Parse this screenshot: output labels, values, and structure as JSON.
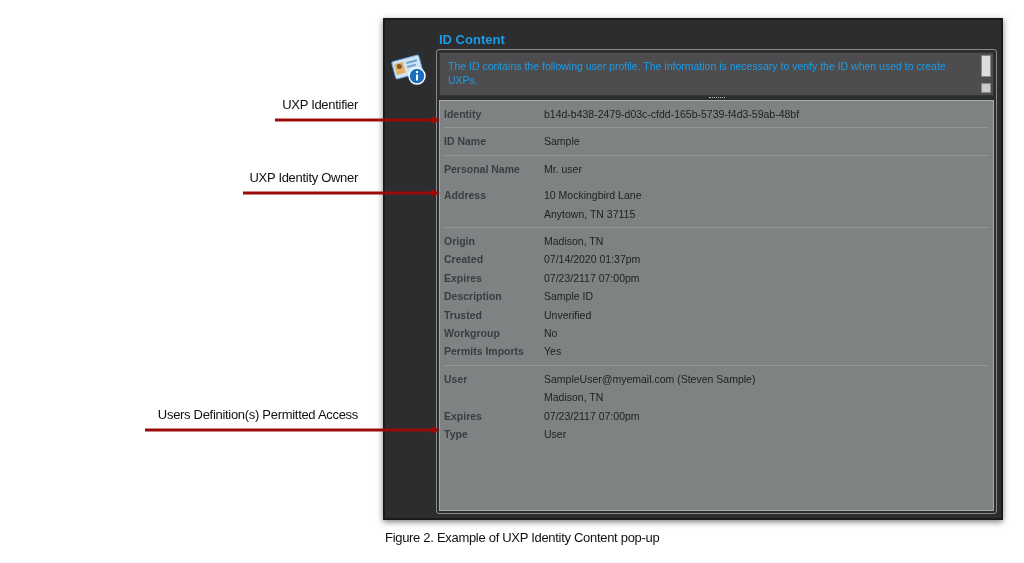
{
  "window": {
    "title": "ID Content",
    "description": "The ID contains the following user profile. The information is necessary to verify the ID when used to create UXPs.",
    "groups": [
      {
        "divider": false,
        "rows": [
          {
            "label": "Identity",
            "values": [
              "b14d-b438-2479-d03c-cfdd-165b-5739-f4d3-59ab-48bf"
            ]
          }
        ]
      },
      {
        "divider": true,
        "rows": [
          {
            "label": "ID Name",
            "values": [
              "Sample"
            ]
          }
        ]
      },
      {
        "divider": true,
        "rows": [
          {
            "label": "Personal Name",
            "values": [
              "Mr. user"
            ]
          }
        ]
      },
      {
        "divider": false,
        "rows": [
          {
            "label": "Address",
            "values": [
              "10 Mockingbird Lane",
              "Anytown, TN 37115"
            ]
          }
        ]
      },
      {
        "divider": true,
        "rows": [
          {
            "label": "Origin",
            "values": [
              "Madison, TN"
            ]
          },
          {
            "label": "Created",
            "values": [
              "07/14/2020 01:37pm"
            ]
          },
          {
            "label": "Expires",
            "values": [
              "07/23/2117 07:00pm"
            ]
          },
          {
            "label": "Description",
            "values": [
              "Sample ID"
            ]
          },
          {
            "label": "Trusted",
            "values": [
              "Unverified"
            ]
          },
          {
            "label": "Workgroup",
            "values": [
              "No"
            ]
          },
          {
            "label": "Permits Imports",
            "values": [
              "Yes"
            ]
          }
        ]
      },
      {
        "divider": true,
        "rows": [
          {
            "label": "User",
            "values": [
              "SampleUser@myemail.com (Steven Sample)",
              "Madison, TN"
            ]
          },
          {
            "label": "Expires",
            "values": [
              "07/23/2117 07:00pm"
            ]
          },
          {
            "label": "Type",
            "values": [
              "User"
            ]
          }
        ]
      }
    ]
  },
  "annotations": [
    {
      "text": "UXP Identifier"
    },
    {
      "text": "UXP Identity Owner"
    },
    {
      "text": "Users Definition(s) Permitted Access"
    }
  ],
  "caption": "Figure 2. Example of UXP Identity Content pop-up"
}
